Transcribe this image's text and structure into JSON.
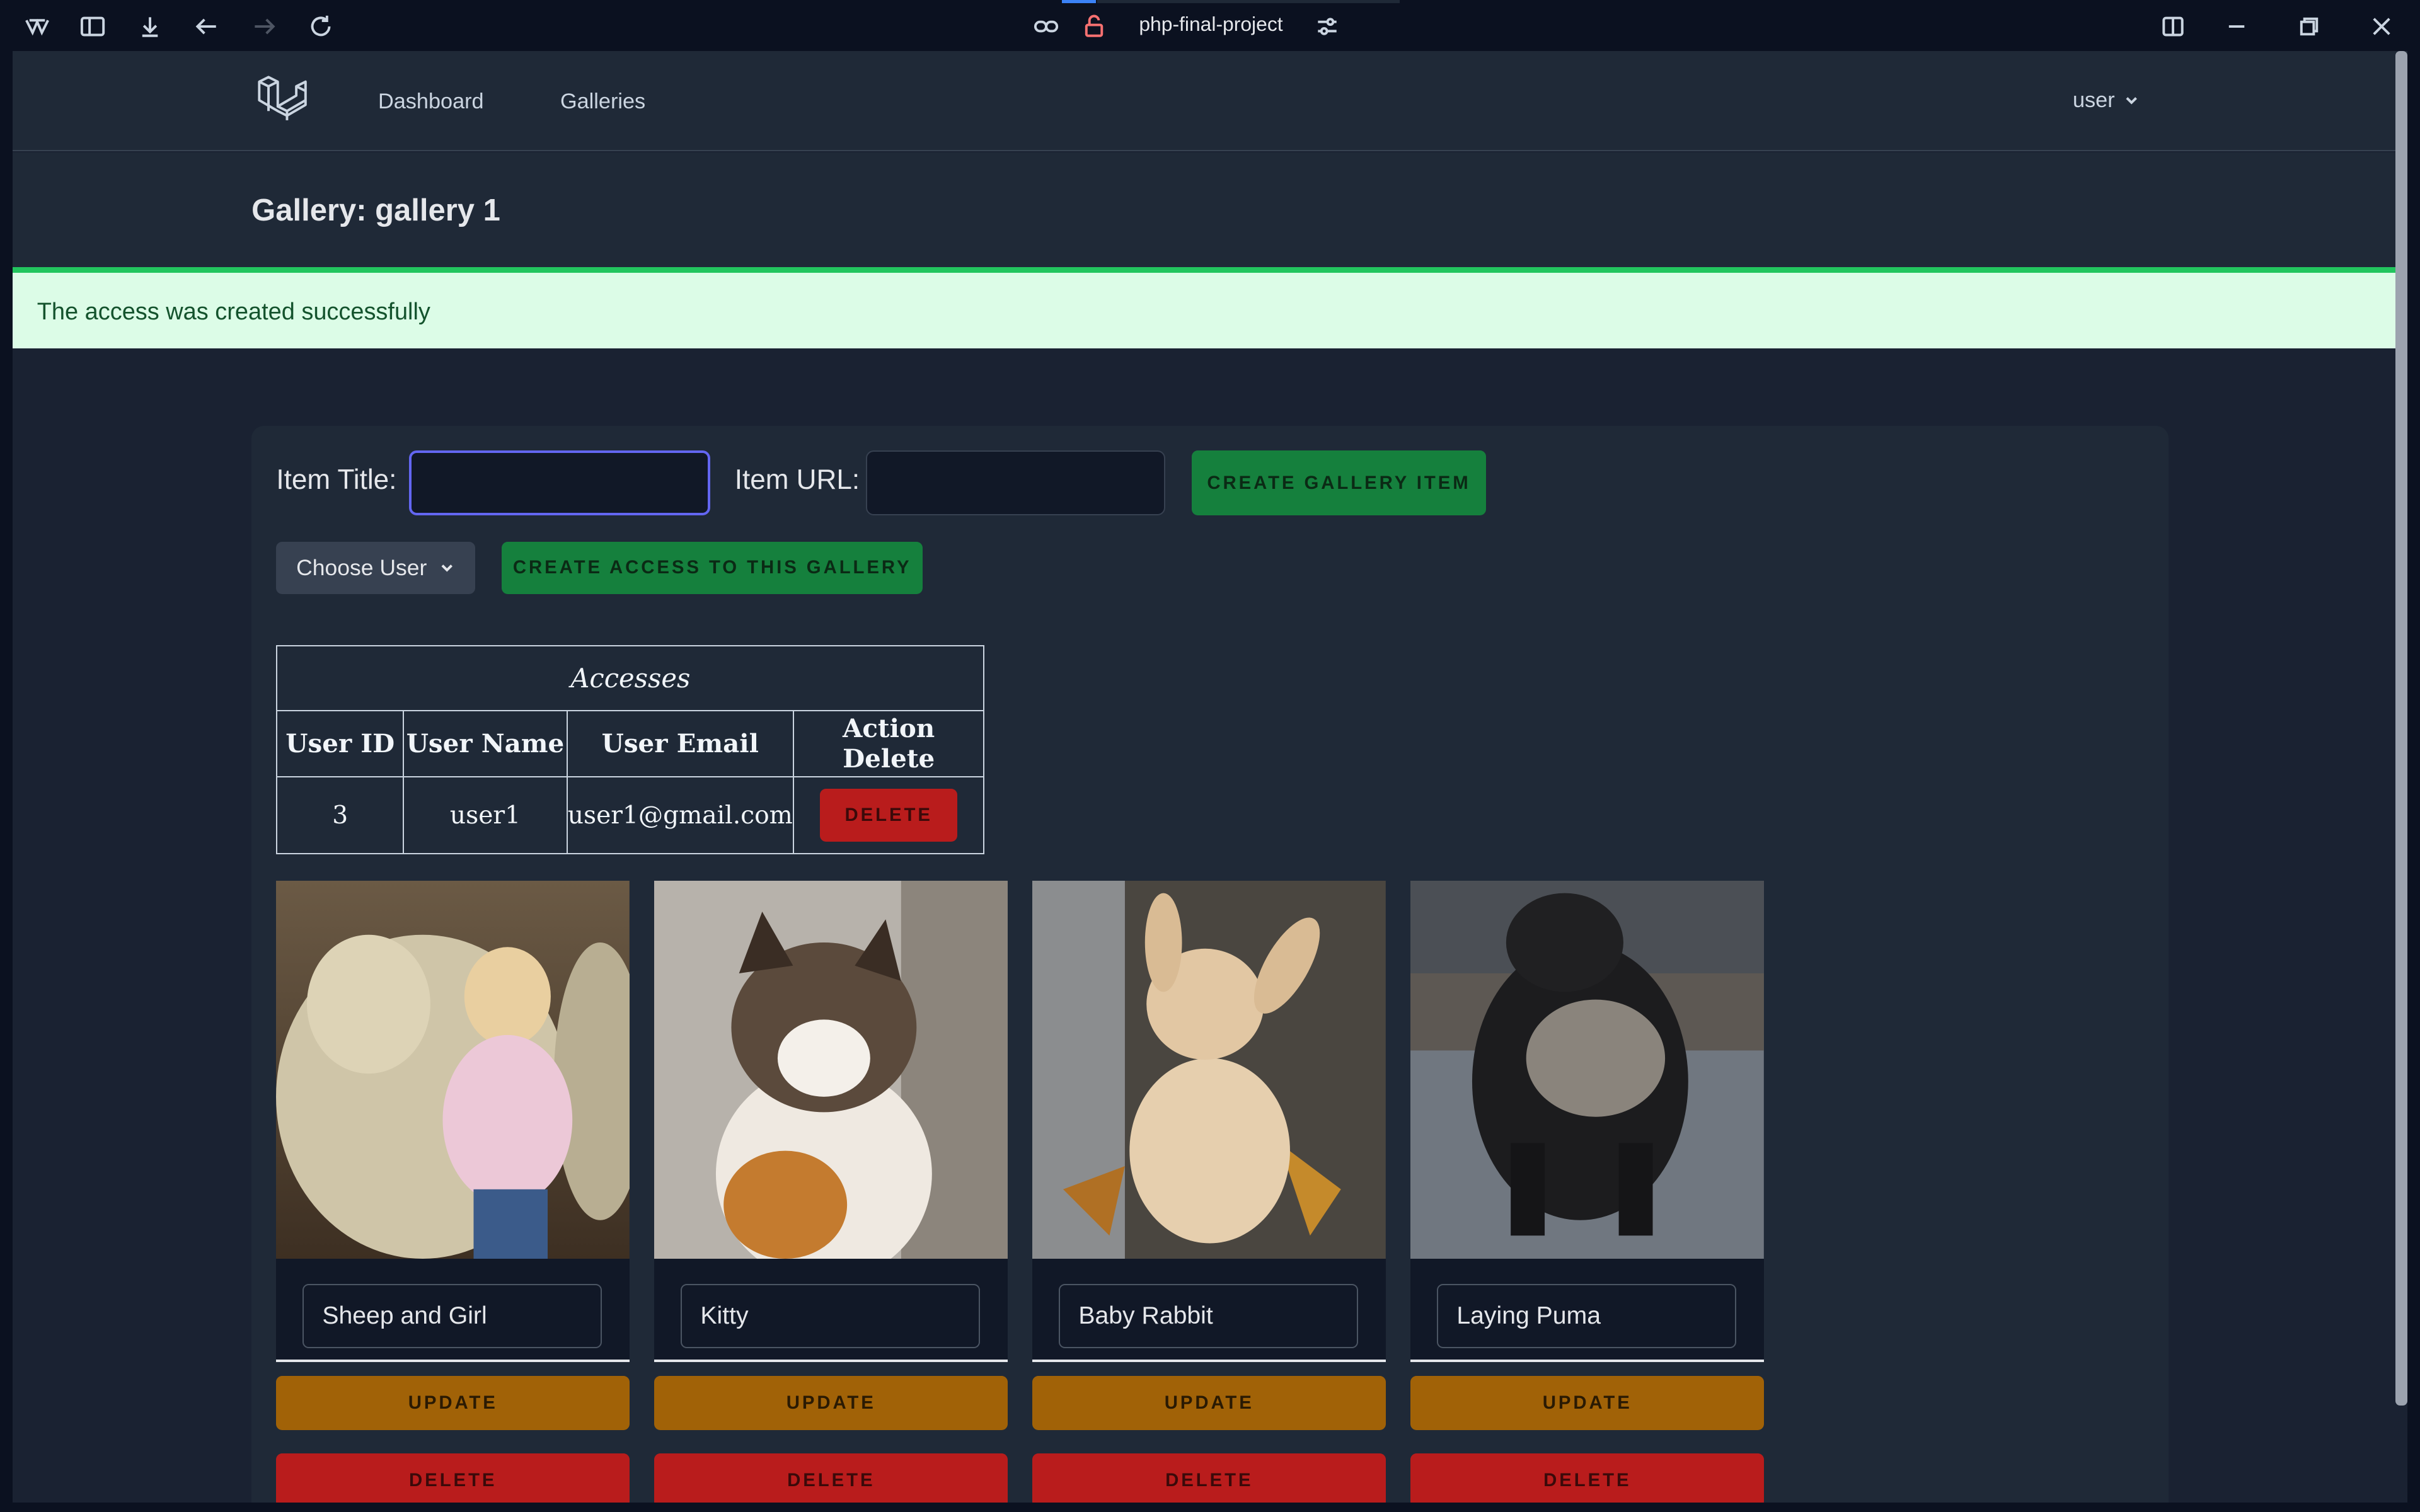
{
  "browser": {
    "url_title": "php-final-project"
  },
  "nav": {
    "links": [
      "Dashboard",
      "Galleries"
    ],
    "user_label": "user"
  },
  "header": {
    "title": "Gallery: gallery 1"
  },
  "alert": {
    "message": "The access was created successfully"
  },
  "form": {
    "item_title_label": "Item Title:",
    "item_title_value": "",
    "item_url_label": "Item URL:",
    "item_url_value": "",
    "create_item_button": "CREATE GALLERY ITEM",
    "choose_user_label": "Choose User",
    "create_access_button": "CREATE ACCESS TO THIS GALLERY"
  },
  "accesses": {
    "title": "Accesses",
    "columns": [
      "User ID",
      "User Name",
      "User Email",
      "Action Delete"
    ],
    "rows": [
      {
        "id": "3",
        "name": "user1",
        "email": "user1@gmail.com",
        "action": "DELETE"
      }
    ]
  },
  "items": [
    {
      "title": "Sheep and Girl",
      "update": "UPDATE",
      "delete": "DELETE"
    },
    {
      "title": "Kitty",
      "update": "UPDATE",
      "delete": "DELETE"
    },
    {
      "title": "Baby Rabbit",
      "update": "UPDATE",
      "delete": "DELETE"
    },
    {
      "title": "Laying Puma",
      "update": "UPDATE",
      "delete": "DELETE"
    }
  ],
  "colors": {
    "success_bg": "#dcfce7",
    "success_border": "#22c55e",
    "green_button": "#15803d",
    "update_button": "#a16207",
    "delete_button": "#b91c1c"
  }
}
